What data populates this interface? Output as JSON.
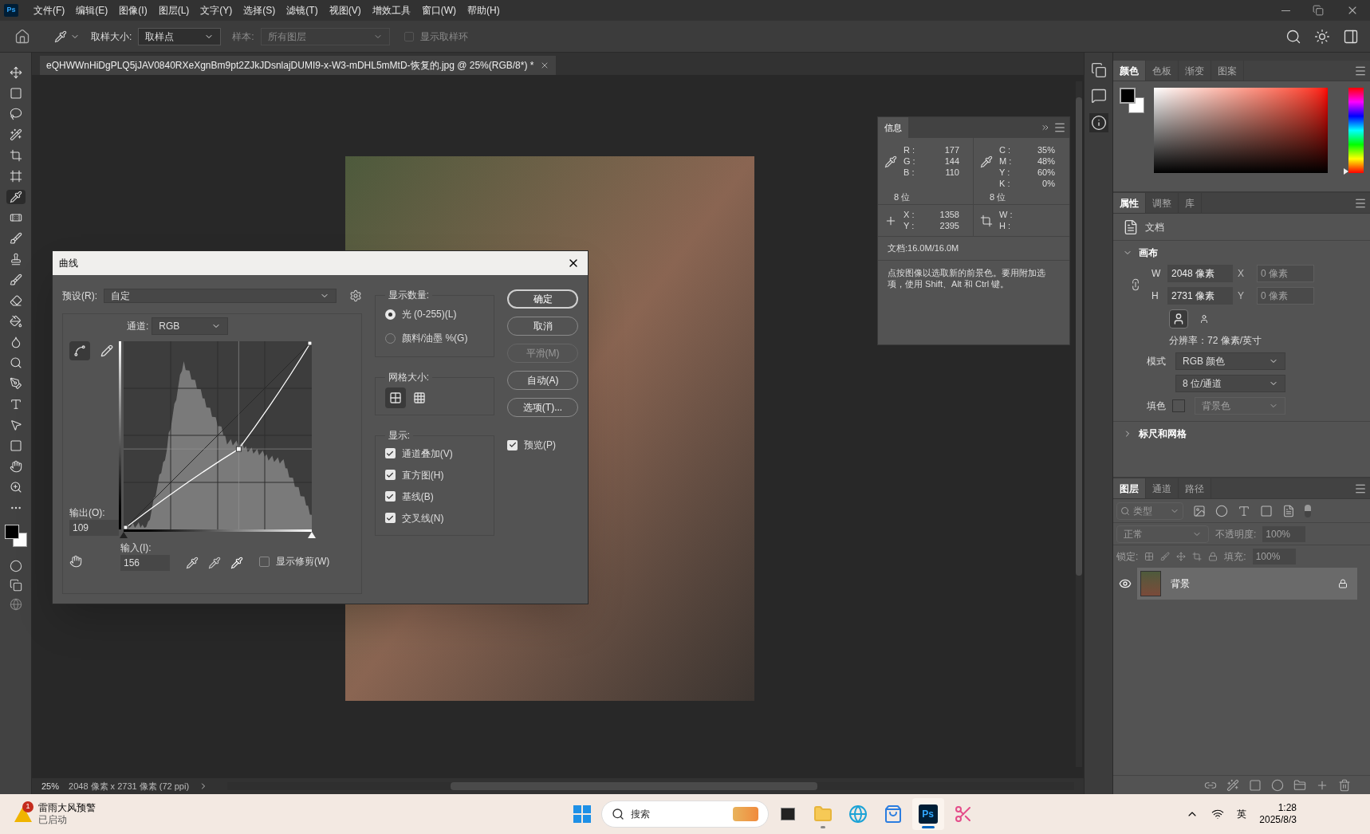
{
  "app": {
    "logo": "Ps",
    "menu": [
      "文件(F)",
      "编辑(E)",
      "图像(I)",
      "图层(L)",
      "文字(Y)",
      "选择(S)",
      "滤镜(T)",
      "视图(V)",
      "增效工具",
      "窗口(W)",
      "帮助(H)"
    ]
  },
  "options_bar": {
    "sample_size_label": "取样大小:",
    "sample_size_value": "取样点",
    "sample_label": "样本:",
    "sample_value": "所有图层",
    "show_ring": {
      "label": "显示取样环",
      "checked": false
    }
  },
  "document_tab": {
    "title": "eQHWWnHiDgPLQ5jJAV0840RXeXgnBm9pt2ZJkJDsnlajDUMI9-x-W3-mDHL5mMtD-恢复的.jpg @ 25%(RGB/8*) *"
  },
  "status_bar": {
    "zoom": "25%",
    "info": "2048 像素 x 2731 像素 (72 ppi)"
  },
  "curves_dialog": {
    "title": "曲线",
    "preset_label": "预设(R):",
    "preset_value": "自定",
    "channel_label": "通道:",
    "channel_value": "RGB",
    "output_label": "输出(O):",
    "output_value": "109",
    "input_label": "输入(I):",
    "input_value": "156",
    "input_sliders": [
      {
        "kind": "shadow",
        "level": 0
      },
      {
        "kind": "highlight",
        "level": 1
      }
    ],
    "curve_tools": [
      {
        "kind": "curve",
        "selected": true
      },
      {
        "kind": "pencil",
        "selected": false
      }
    ],
    "show_clipping": {
      "label": "显示修剪(W)",
      "checked": false
    },
    "display_amount": {
      "title": "显示数量:",
      "options": [
        {
          "label": "光 (0-255)(L)",
          "selected": true
        },
        {
          "label": "颜料/油墨 %(G)",
          "selected": false
        }
      ]
    },
    "grid_size": {
      "title": "网格大小:",
      "options": [
        {
          "kind": "simple",
          "selected": true
        },
        {
          "kind": "detailed",
          "selected": false
        }
      ]
    },
    "display": {
      "title": "显示:",
      "options": [
        {
          "label": "通道叠加(V)",
          "checked": true
        },
        {
          "label": "直方图(H)",
          "checked": true
        },
        {
          "label": "基线(B)",
          "checked": true
        },
        {
          "label": "交叉线(N)",
          "checked": true
        }
      ]
    },
    "buttons": [
      {
        "label": "确定",
        "disabled": false,
        "default": true
      },
      {
        "label": "取消",
        "disabled": false,
        "default": false
      },
      {
        "label": "平滑(M)",
        "disabled": true,
        "default": false
      },
      {
        "label": "自动(A)",
        "disabled": false,
        "default": false
      },
      {
        "label": "选项(T)...",
        "disabled": false,
        "default": false
      }
    ],
    "preview": {
      "label": "预览(P)",
      "checked": true
    }
  },
  "info_panel": {
    "tab": "信息",
    "rgb": [
      {
        "label": "R :",
        "value": "177"
      },
      {
        "label": "G :",
        "value": "144"
      },
      {
        "label": "B :",
        "value": "110"
      }
    ],
    "rgb_depth": "8 位",
    "cmyk": [
      {
        "label": "C :",
        "value": "35%"
      },
      {
        "label": "M :",
        "value": "48%"
      },
      {
        "label": "Y :",
        "value": "60%"
      },
      {
        "label": "K :",
        "value": "0%"
      }
    ],
    "cmyk_depth": "8 位",
    "position": [
      {
        "label": "X :",
        "value": "1358"
      },
      {
        "label": "Y :",
        "value": "2395"
      }
    ],
    "size": [
      {
        "label": "W :"
      },
      {
        "label": "H :"
      }
    ],
    "document": "文档:16.0M/16.0M",
    "hint": "点按图像以选取新的前景色。要用附加选项，使用 Shift、Alt 和 Ctrl 键。"
  },
  "color_panel": {
    "hue_slider": {
      "level": 0
    },
    "tabs": [
      {
        "label": "颜色",
        "selected": true
      },
      {
        "label": "色板",
        "selected": false
      },
      {
        "label": "渐变",
        "selected": false
      },
      {
        "label": "图案",
        "selected": false
      }
    ]
  },
  "properties_panel": {
    "tabs": [
      {
        "label": "属性",
        "selected": true
      },
      {
        "label": "调整",
        "selected": false
      },
      {
        "label": "库",
        "selected": false
      }
    ],
    "document_label": "文档",
    "canvas_section": {
      "title": "画布",
      "expanded": true,
      "fields": [
        {
          "label": "W",
          "value": "2048 像素",
          "disabled": false
        },
        {
          "label": "X",
          "value": "0 像素",
          "disabled": true
        },
        {
          "label": "H",
          "value": "2731 像素",
          "disabled": false
        },
        {
          "label": "Y",
          "value": "0 像素",
          "disabled": true
        }
      ],
      "orientation": [
        {
          "kind": "portrait",
          "selected": true
        },
        {
          "kind": "landscape",
          "selected": false
        }
      ],
      "resolution": "分辨率：72 像素/英寸",
      "mode_label": "模式",
      "mode": "RGB 颜色",
      "depth": "8 位/通道",
      "fill_label": "填色",
      "fill": "背景色"
    },
    "rulers_section": {
      "title": "标尺和网格",
      "expanded": false
    }
  },
  "layers_panel": {
    "tabs": [
      {
        "label": "图层",
        "selected": true
      },
      {
        "label": "通道",
        "selected": false
      },
      {
        "label": "路径",
        "selected": false
      }
    ],
    "filter_placeholder": "类型",
    "blend_mode": "正常",
    "opacity_label": "不透明度:",
    "opacity": "100%",
    "lock_label": "锁定:",
    "fill_label": "填充:",
    "fill": "100%",
    "layers": [
      {
        "name": "背景",
        "visible": true,
        "locked": true,
        "selected": true
      }
    ]
  },
  "taskbar": {
    "alert": {
      "badge": "1",
      "title": "雷雨大风预警",
      "subtitle": "已启动"
    },
    "search_placeholder": "搜索",
    "apps": [
      {
        "kind": "taskview",
        "running": false,
        "active": false
      },
      {
        "kind": "explorer",
        "running": true,
        "active": false
      },
      {
        "kind": "edge",
        "running": false,
        "active": false
      },
      {
        "kind": "store",
        "running": false,
        "active": false
      },
      {
        "kind": "photoshop",
        "running": true,
        "active": true,
        "label": "Ps"
      },
      {
        "kind": "snipping",
        "running": false,
        "active": false
      }
    ],
    "ime": "英",
    "time": "1:28",
    "date": "2025/8/3"
  }
}
